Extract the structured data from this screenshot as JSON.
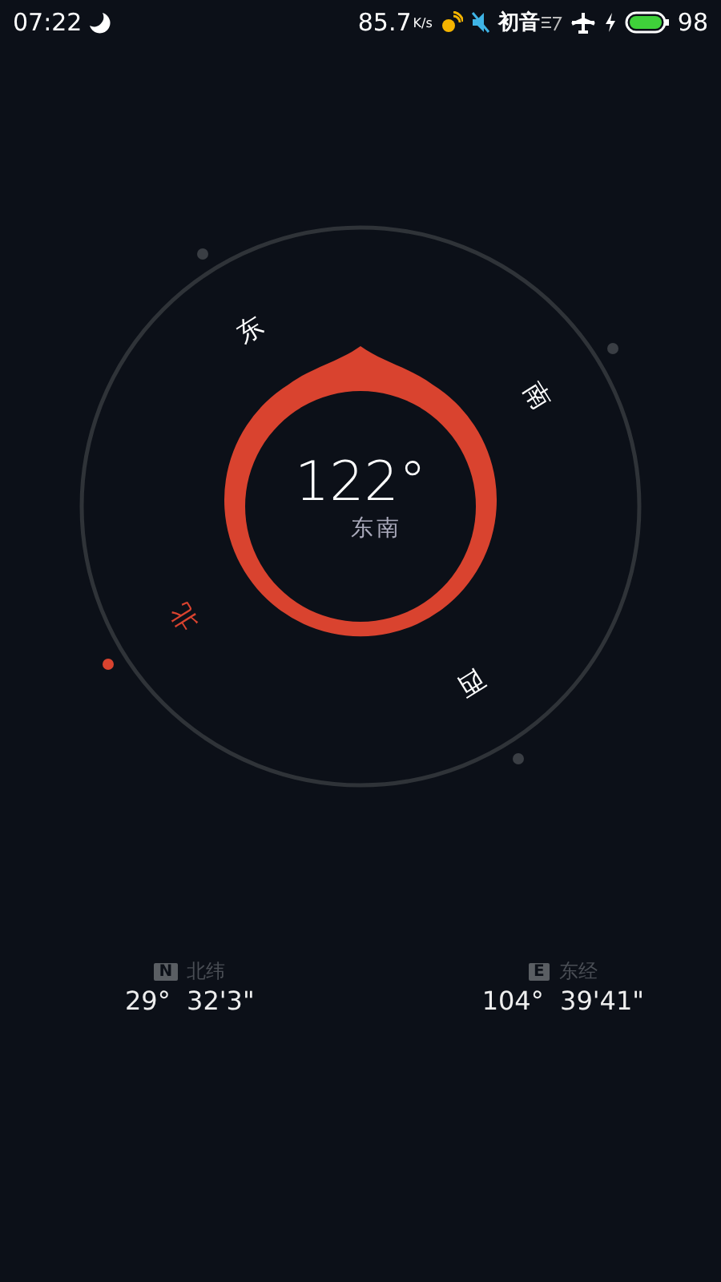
{
  "status_bar": {
    "time": "07:22",
    "speed": "85.7",
    "speed_unit": "K/s",
    "carrier": "初音",
    "battery": "98"
  },
  "compass": {
    "heading": "122°",
    "direction": "东南",
    "points": [
      {
        "label": "北",
        "selected": true
      },
      {
        "label": "东",
        "selected": false
      },
      {
        "label": "南",
        "selected": false
      },
      {
        "label": "西",
        "selected": false
      }
    ]
  },
  "coordinates": [
    {
      "badge": "N",
      "label": "北纬",
      "value": "29°  32'3\""
    },
    {
      "badge": "E",
      "label": "东经",
      "value": "104°  39'41\""
    }
  ]
}
